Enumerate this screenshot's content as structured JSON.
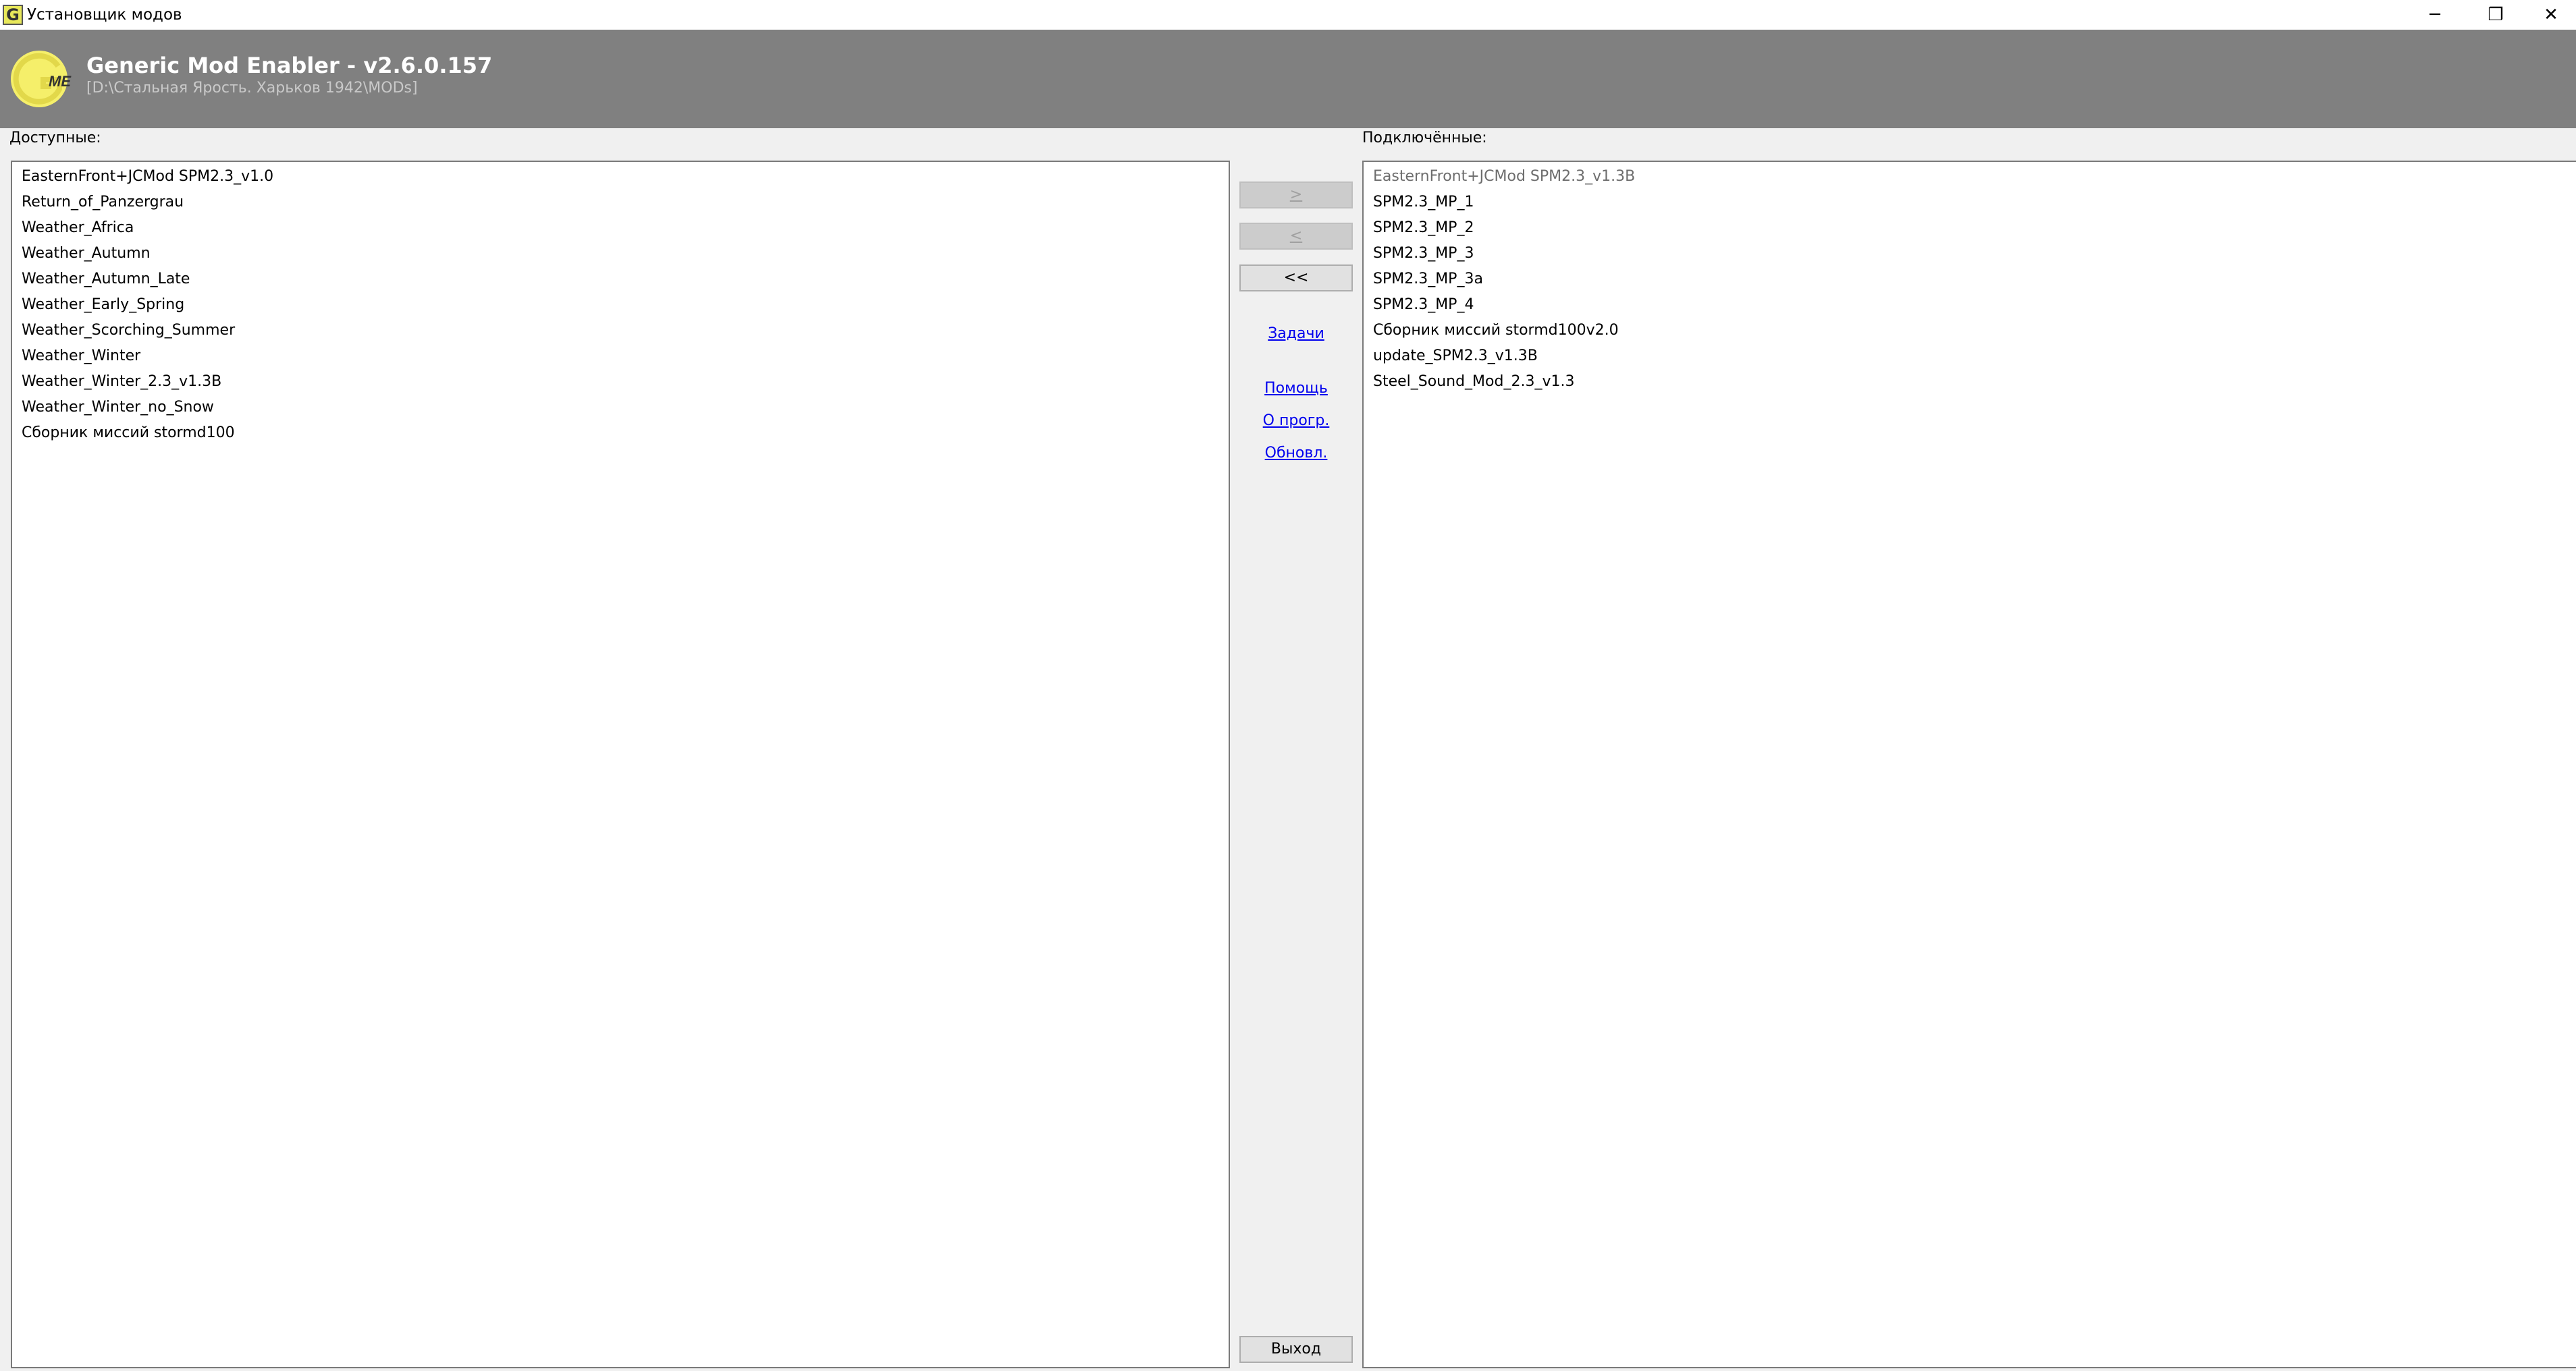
{
  "window": {
    "title": "Установщик модов",
    "icon_letter": "G",
    "controls": {
      "minimize": "─",
      "restore": "❐",
      "close": "✕"
    }
  },
  "header": {
    "app_name": "Generic Mod Enabler - v2.6.0.157",
    "mods_path": "[D:\\Стальная Ярость. Харьков 1942\\MODs]",
    "logo": {
      "letter": "G",
      "subtext": "ME",
      "color": "#f5ef6a"
    }
  },
  "available": {
    "label": "Доступные:",
    "items": [
      "EasternFront+JCMod SPM2.3_v1.0",
      "Return_of_Panzergrau",
      "Weather_Africa",
      "Weather_Autumn",
      "Weather_Autumn_Late",
      "Weather_Early_Spring",
      "Weather_Scorching_Summer",
      "Weather_Winter",
      "Weather_Winter_2.3_v1.3B",
      "Weather_Winter_no_Snow",
      "Сборник миссий stormd100"
    ]
  },
  "enabled": {
    "label": "Подключённые:",
    "items": [
      "EasternFront+JCMod SPM2.3_v1.3B",
      "SPM2.3_MP_1",
      "SPM2.3_MP_2",
      "SPM2.3_MP_3",
      "SPM2.3_MP_3a",
      "SPM2.3_MP_4",
      "Сборник миссий stormd100v2.0",
      "update_SPM2.3_v1.3B",
      "Steel_Sound_Mod_2.3_v1.3"
    ]
  },
  "controls": {
    "add": ">",
    "remove": "<",
    "remove_all": "<<",
    "tasks": "Задачи",
    "help": "Помощь",
    "about": "О прогр.",
    "update": "Обновл.",
    "exit": "Выход"
  }
}
